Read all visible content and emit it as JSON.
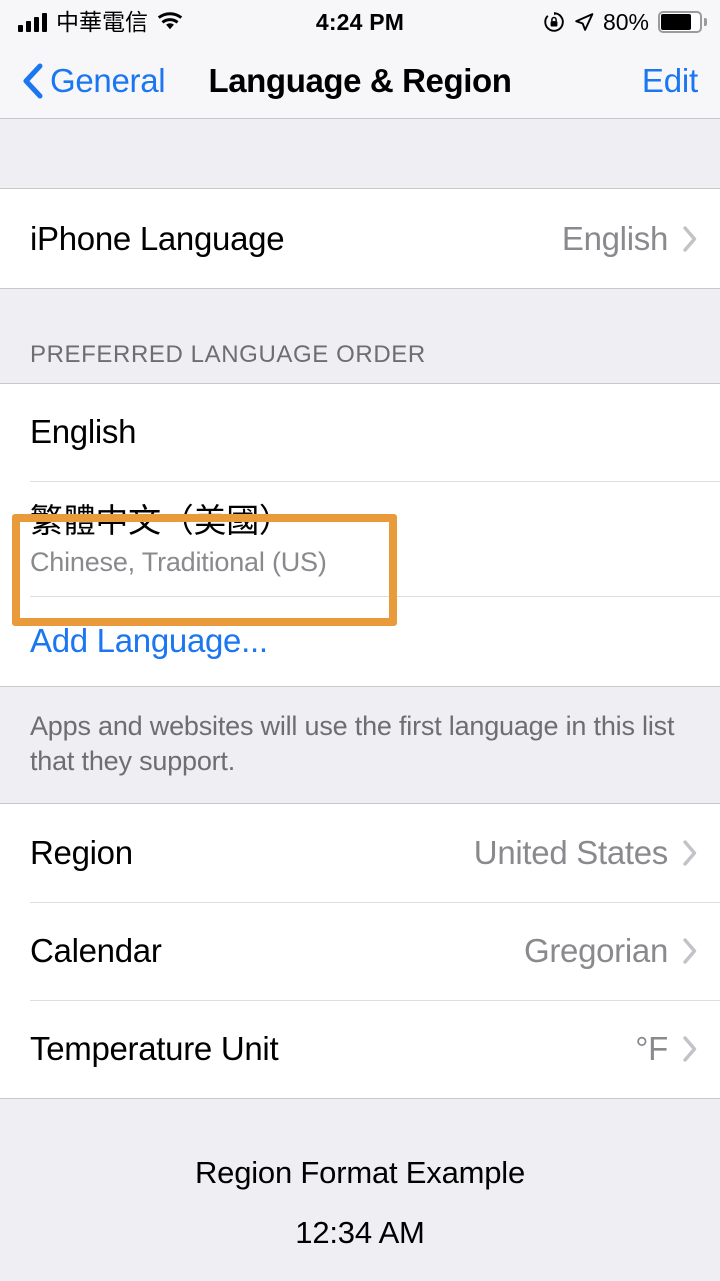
{
  "status_bar": {
    "carrier": "中華電信",
    "time": "4:24 PM",
    "battery_percent": "80%",
    "signal_icon": "signal-bars-icon",
    "wifi_icon": "wifi-icon",
    "rotation_lock_icon": "rotation-lock-icon",
    "location_icon": "location-arrow-icon",
    "battery_icon": "battery-icon",
    "battery_level": 80
  },
  "nav": {
    "back_label": "General",
    "title": "Language & Region",
    "edit_label": "Edit"
  },
  "iphone_language": {
    "label": "iPhone Language",
    "value": "English"
  },
  "preferred_language_order": {
    "header": "PREFERRED LANGUAGE ORDER",
    "items": [
      {
        "primary": "English",
        "secondary": ""
      },
      {
        "primary": "繁體中文（美國）",
        "secondary": "Chinese, Traditional (US)"
      }
    ],
    "add_language_label": "Add Language...",
    "footer": "Apps and websites will use the first language in this list that they support."
  },
  "region_settings": {
    "rows": [
      {
        "label": "Region",
        "value": "United States"
      },
      {
        "label": "Calendar",
        "value": "Gregorian"
      },
      {
        "label": "Temperature Unit",
        "value": "°F"
      }
    ]
  },
  "region_format_example": {
    "title": "Region Format Example",
    "time": "12:34 AM"
  },
  "colors": {
    "accent_blue": "#1B76F2",
    "highlight_orange": "#E99B3C",
    "group_background": "#FFFFFF",
    "page_background": "#EFEEF3",
    "secondary_text": "#8A8A8E"
  }
}
